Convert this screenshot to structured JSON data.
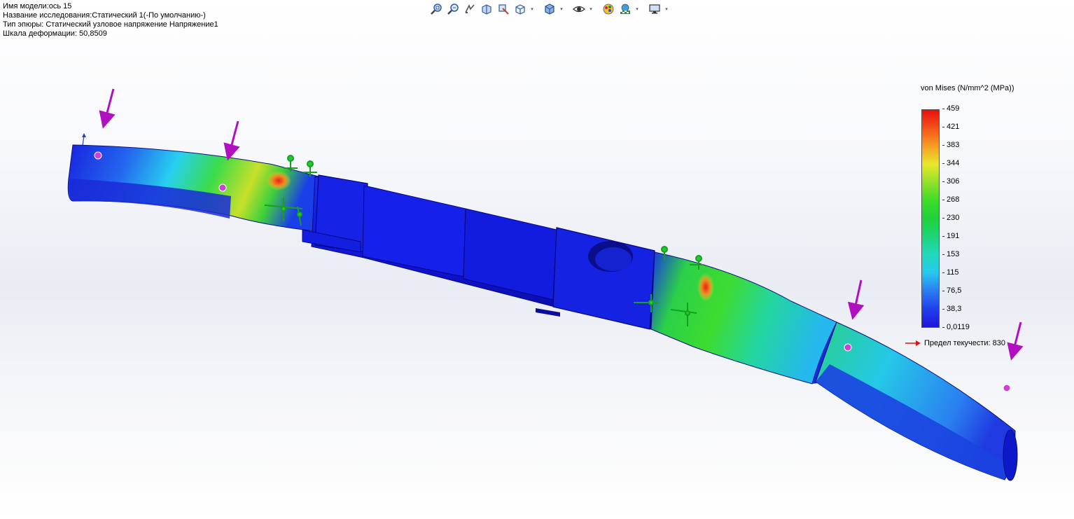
{
  "study_info": {
    "model_name": "Имя модели:ось 15",
    "study_name": "Название исследования:Статический 1(-По умолчанию-)",
    "plot_type": "Тип эпюры: Статический узловое напряжение Напряжение1",
    "deformation_scale": "Шкала деформации: 50,8509"
  },
  "toolbar": {
    "buttons": [
      {
        "name": "zoom-to-fit-icon",
        "dropdown": false
      },
      {
        "name": "zoom-to-area-icon",
        "dropdown": false
      },
      {
        "name": "previous-view-icon",
        "dropdown": false
      },
      {
        "name": "section-view-icon",
        "dropdown": false
      },
      {
        "name": "dynamic-annotation-icon",
        "dropdown": false
      },
      {
        "name": "view-orientation-icon",
        "dropdown": true
      },
      {
        "name": "display-style-icon",
        "dropdown": true
      },
      {
        "name": "hide-show-items-icon",
        "dropdown": true
      },
      {
        "name": "edit-appearance-icon",
        "dropdown": false
      },
      {
        "name": "apply-scene-icon",
        "dropdown": true
      },
      {
        "name": "view-settings-icon",
        "dropdown": true
      }
    ]
  },
  "legend": {
    "title": "von Mises (N/mm^2 (MPa))",
    "values": [
      "459",
      "421",
      "383",
      "344",
      "306",
      "268",
      "230",
      "191",
      "153",
      "115",
      "76,5",
      "38,3",
      "0,0119"
    ],
    "colors_top_to_bottom": [
      "#e8100f",
      "#f4521a",
      "#f69d25",
      "#e8e82a",
      "#94e02a",
      "#3ddc29",
      "#1fd13a",
      "#1ed37a",
      "#22d9bd",
      "#27c8ef",
      "#2a7df0",
      "#213fec",
      "#1d16d9"
    ],
    "yield_label": "Предел текучести: 830",
    "yield_arrow_color": "#e01010"
  },
  "colors": {
    "shaft_base": "#0e14d6",
    "shaft_dark": "#0a0d9c",
    "load_arrow": "#b010c0",
    "fixture": "#1cbf2a",
    "hot_spot": "#e8201a"
  }
}
